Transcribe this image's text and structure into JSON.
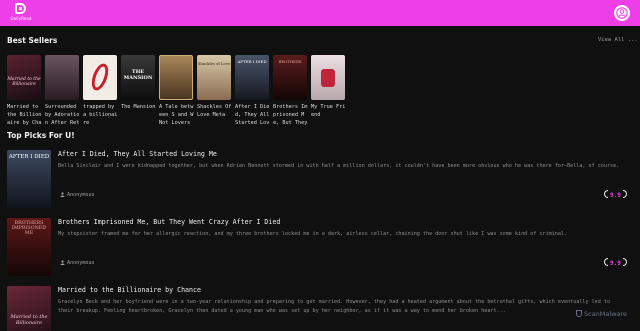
{
  "header": {
    "logo_text": "DailyRead",
    "brand_color": "#ee3ee8"
  },
  "best_sellers": {
    "title": "Best Sellers",
    "view_all": "View All ...",
    "books": [
      {
        "title": "Married to the Billionaire by Chance",
        "cover_text": "Married to the Billionaire",
        "cover_bg": "#3a1a2a"
      },
      {
        "title": "Surrounded by Adoration After Return",
        "cover_text": "",
        "cover_bg": "#4a3a40"
      },
      {
        "title": "trapped by a billionaire",
        "cover_text": "",
        "cover_bg": "#f1ece6"
      },
      {
        "title": "The Mansion",
        "cover_text": "THE MANSION",
        "cover_bg": "#1e1e1e"
      },
      {
        "title": "A Tale between S and W Not Lovers",
        "cover_text": "",
        "cover_bg": "#8a6a46"
      },
      {
        "title": "Shackles Of Love Meta",
        "cover_text": "Shackles of Love",
        "cover_bg": "#c9b89a"
      },
      {
        "title": "After I Died, They All Started Loving Me",
        "cover_text": "AFTER I DIED",
        "cover_bg": "#2c3240"
      },
      {
        "title": "Brothers Imprisoned Me, But They Went Crazy After I Died",
        "cover_text": "BROTHERS",
        "cover_bg": "#3a1414"
      },
      {
        "title": "My True Friend",
        "cover_text": "",
        "cover_bg": "#d9d2d4"
      }
    ]
  },
  "top_picks": {
    "title": "Top Picks For U!",
    "items": [
      {
        "title": "After I Died, They All Started Loving Me",
        "description": "Bella Sinclair and I were kidnapped together, but when Adrian Bennett stormed in with half a million dollars, it couldn't have been more obvious who he was there for—Bella, of course.",
        "author": "Anonymous",
        "rating": "9.9",
        "cover_text": "AFTER I DIED",
        "cover_bg": "#283040"
      },
      {
        "title": "Brothers Imprisoned Me, But They Went Crazy After I Died",
        "description": "My stepsister framed me for her allergic reaction, and my three brothers locked me in a dark, airless cellar, chaining the door shut like I was some kind of criminal.",
        "author": "Anonymous",
        "rating": "9.9",
        "cover_text": "BROTHERS IMPRISONED ME",
        "cover_bg": "#3a1212"
      },
      {
        "title": "Married to the Billionaire by Chance",
        "description": "Gracelyn Beck and her boyfriend were in a two-year relationship and preparing to get married. However, they had a heated argument about the betrothal gifts, which eventually led to their breakup. Feeling heartbroken, Gracelyn then dated a young man who was set up by her neighbor, as if it was a way to mend her broken heart...",
        "author": "",
        "rating": "",
        "cover_text": "Married to the Billionaire",
        "cover_bg": "#3a1a2a"
      }
    ]
  },
  "watermark": "ScanMalware"
}
